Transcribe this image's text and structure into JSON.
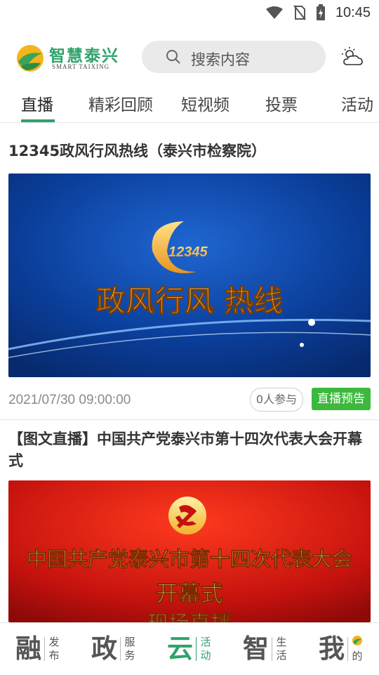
{
  "status_bar": {
    "time": "10:45",
    "icons": [
      "wifi-icon",
      "no-sim-icon",
      "battery-charging-icon"
    ]
  },
  "header": {
    "logo_text": "智慧泰兴",
    "logo_subtext": "SMART TAIXING",
    "search_placeholder": "搜索内容",
    "weather_icon": "partly-cloudy-icon"
  },
  "tabs": [
    {
      "label": "直播",
      "active": true
    },
    {
      "label": "精彩回顾",
      "active": false
    },
    {
      "label": "短视频",
      "active": false
    },
    {
      "label": "投票",
      "active": false
    },
    {
      "label": "活动",
      "active": false
    }
  ],
  "feed": [
    {
      "title": "12345政风行风热线（泰兴市检察院）",
      "banner_logo_text": "12345",
      "banner_text": "政风行风 热线",
      "date": "2021/07/30 09:00:00",
      "participants": "0人参与",
      "status": "直播预告"
    },
    {
      "title": "【图文直播】中国共产党泰兴市第十四次代表大会开幕式",
      "banner_line1": "中国共产党泰兴市第十四次代表大会",
      "banner_line2": "开幕式",
      "banner_line3": "现场直播"
    }
  ],
  "bottom_nav": [
    {
      "big": "融",
      "small1": "发",
      "small2": "布",
      "active": false
    },
    {
      "big": "政",
      "small1": "服",
      "small2": "务",
      "active": false
    },
    {
      "big": "云",
      "small1": "活",
      "small2": "动",
      "active": true
    },
    {
      "big": "智",
      "small1": "生",
      "small2": "活",
      "active": false
    },
    {
      "big": "我",
      "small1": "",
      "small2": "的",
      "active": false
    }
  ],
  "colors": {
    "accent": "#2ea36a",
    "preview_badge": "#3db83d",
    "banner_blue": "#0b3f9c",
    "banner_red": "#c5120e"
  }
}
